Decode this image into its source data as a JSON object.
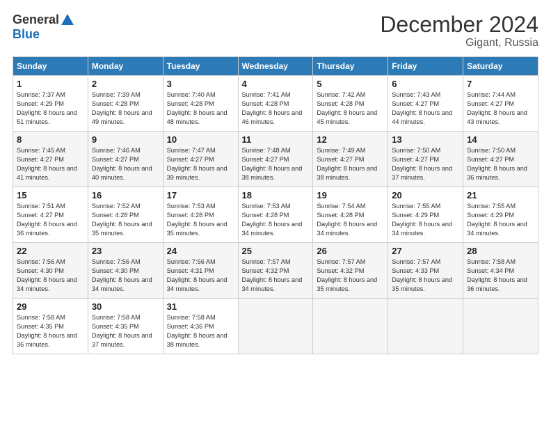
{
  "logo": {
    "general": "General",
    "blue": "Blue"
  },
  "title": "December 2024",
  "subtitle": "Gigant, Russia",
  "headers": [
    "Sunday",
    "Monday",
    "Tuesday",
    "Wednesday",
    "Thursday",
    "Friday",
    "Saturday"
  ],
  "weeks": [
    [
      {
        "day": "1",
        "sunrise": "7:37 AM",
        "sunset": "4:29 PM",
        "daylight": "8 hours and 51 minutes."
      },
      {
        "day": "2",
        "sunrise": "7:39 AM",
        "sunset": "4:28 PM",
        "daylight": "8 hours and 49 minutes."
      },
      {
        "day": "3",
        "sunrise": "7:40 AM",
        "sunset": "4:28 PM",
        "daylight": "8 hours and 48 minutes."
      },
      {
        "day": "4",
        "sunrise": "7:41 AM",
        "sunset": "4:28 PM",
        "daylight": "8 hours and 46 minutes."
      },
      {
        "day": "5",
        "sunrise": "7:42 AM",
        "sunset": "4:28 PM",
        "daylight": "8 hours and 45 minutes."
      },
      {
        "day": "6",
        "sunrise": "7:43 AM",
        "sunset": "4:27 PM",
        "daylight": "8 hours and 44 minutes."
      },
      {
        "day": "7",
        "sunrise": "7:44 AM",
        "sunset": "4:27 PM",
        "daylight": "8 hours and 43 minutes."
      }
    ],
    [
      {
        "day": "8",
        "sunrise": "7:45 AM",
        "sunset": "4:27 PM",
        "daylight": "8 hours and 41 minutes."
      },
      {
        "day": "9",
        "sunrise": "7:46 AM",
        "sunset": "4:27 PM",
        "daylight": "8 hours and 40 minutes."
      },
      {
        "day": "10",
        "sunrise": "7:47 AM",
        "sunset": "4:27 PM",
        "daylight": "8 hours and 39 minutes."
      },
      {
        "day": "11",
        "sunrise": "7:48 AM",
        "sunset": "4:27 PM",
        "daylight": "8 hours and 38 minutes."
      },
      {
        "day": "12",
        "sunrise": "7:49 AM",
        "sunset": "4:27 PM",
        "daylight": "8 hours and 38 minutes."
      },
      {
        "day": "13",
        "sunrise": "7:50 AM",
        "sunset": "4:27 PM",
        "daylight": "8 hours and 37 minutes."
      },
      {
        "day": "14",
        "sunrise": "7:50 AM",
        "sunset": "4:27 PM",
        "daylight": "8 hours and 36 minutes."
      }
    ],
    [
      {
        "day": "15",
        "sunrise": "7:51 AM",
        "sunset": "4:27 PM",
        "daylight": "8 hours and 36 minutes."
      },
      {
        "day": "16",
        "sunrise": "7:52 AM",
        "sunset": "4:28 PM",
        "daylight": "8 hours and 35 minutes."
      },
      {
        "day": "17",
        "sunrise": "7:53 AM",
        "sunset": "4:28 PM",
        "daylight": "8 hours and 35 minutes."
      },
      {
        "day": "18",
        "sunrise": "7:53 AM",
        "sunset": "4:28 PM",
        "daylight": "8 hours and 34 minutes."
      },
      {
        "day": "19",
        "sunrise": "7:54 AM",
        "sunset": "4:28 PM",
        "daylight": "8 hours and 34 minutes."
      },
      {
        "day": "20",
        "sunrise": "7:55 AM",
        "sunset": "4:29 PM",
        "daylight": "8 hours and 34 minutes."
      },
      {
        "day": "21",
        "sunrise": "7:55 AM",
        "sunset": "4:29 PM",
        "daylight": "8 hours and 34 minutes."
      }
    ],
    [
      {
        "day": "22",
        "sunrise": "7:56 AM",
        "sunset": "4:30 PM",
        "daylight": "8 hours and 34 minutes."
      },
      {
        "day": "23",
        "sunrise": "7:56 AM",
        "sunset": "4:30 PM",
        "daylight": "8 hours and 34 minutes."
      },
      {
        "day": "24",
        "sunrise": "7:56 AM",
        "sunset": "4:31 PM",
        "daylight": "8 hours and 34 minutes."
      },
      {
        "day": "25",
        "sunrise": "7:57 AM",
        "sunset": "4:32 PM",
        "daylight": "8 hours and 34 minutes."
      },
      {
        "day": "26",
        "sunrise": "7:57 AM",
        "sunset": "4:32 PM",
        "daylight": "8 hours and 35 minutes."
      },
      {
        "day": "27",
        "sunrise": "7:57 AM",
        "sunset": "4:33 PM",
        "daylight": "8 hours and 35 minutes."
      },
      {
        "day": "28",
        "sunrise": "7:58 AM",
        "sunset": "4:34 PM",
        "daylight": "8 hours and 36 minutes."
      }
    ],
    [
      {
        "day": "29",
        "sunrise": "7:58 AM",
        "sunset": "4:35 PM",
        "daylight": "8 hours and 36 minutes."
      },
      {
        "day": "30",
        "sunrise": "7:58 AM",
        "sunset": "4:35 PM",
        "daylight": "8 hours and 37 minutes."
      },
      {
        "day": "31",
        "sunrise": "7:58 AM",
        "sunset": "4:36 PM",
        "daylight": "8 hours and 38 minutes."
      },
      null,
      null,
      null,
      null
    ]
  ],
  "labels": {
    "sunrise": "Sunrise:",
    "sunset": "Sunset:",
    "daylight": "Daylight:"
  }
}
